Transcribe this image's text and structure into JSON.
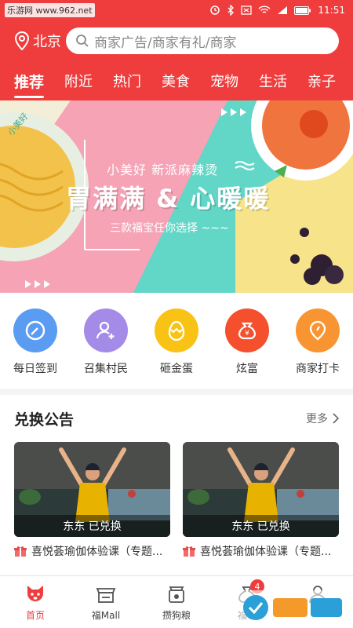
{
  "status": {
    "watermark_left": "乐游网 www.962.net",
    "time": "11:51"
  },
  "header": {
    "city": "北京",
    "search_placeholder": "商家广告/商家有礼/商家",
    "tabs": [
      "推荐",
      "附近",
      "热门",
      "美食",
      "宠物",
      "生活",
      "亲子"
    ]
  },
  "banner": {
    "line1": "小美好 新派麻辣烫",
    "line2": "胃满满 & 心暖暖",
    "line3": "三款福宝任你选择 ~~~",
    "bowl_label": "小美好"
  },
  "quick_actions": [
    {
      "label": "每日签到",
      "icon": "check-in-icon",
      "color": "#5a9cf2"
    },
    {
      "label": "召集村民",
      "icon": "add-user-icon",
      "color": "#a58be8"
    },
    {
      "label": "砸金蛋",
      "icon": "golden-egg-icon",
      "color": "#f9c316"
    },
    {
      "label": "炫富",
      "icon": "money-bag-icon",
      "color": "#f4502e"
    },
    {
      "label": "商家打卡",
      "icon": "map-pin-icon",
      "color": "#f99432"
    }
  ],
  "exchange": {
    "title": "兑换公告",
    "more": "更多",
    "cards": [
      {
        "overlay": "东东 已兑换",
        "caption": "喜悦荟瑜伽体验课（专题..."
      },
      {
        "overlay": "东东 已兑换",
        "caption": "喜悦荟瑜伽体验课（专题..."
      }
    ]
  },
  "bottom_nav": [
    {
      "label": "首页",
      "icon": "dog-home-icon",
      "active": true
    },
    {
      "label": "福Mall",
      "icon": "store-icon",
      "active": false
    },
    {
      "label": "攒狗粮",
      "icon": "dog-food-icon",
      "active": false
    },
    {
      "label": "福袋",
      "icon": "lucky-bag-icon",
      "active": false,
      "badge": "4"
    },
    {
      "label": "",
      "icon": "profile-icon",
      "active": false
    }
  ],
  "colors": {
    "brand_red": "#ef3d3d"
  }
}
